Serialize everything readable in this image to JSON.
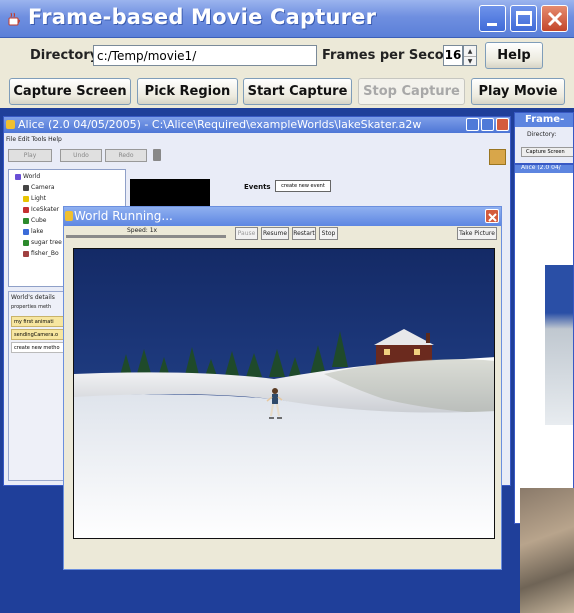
{
  "window": {
    "title": "Frame-based Movie Capturer"
  },
  "form": {
    "directory_label": "Directory:",
    "directory_value": "c:/Temp/movie1/",
    "fps_label": "Frames per Second:",
    "fps_value": "16",
    "help_label": "Help"
  },
  "toolbar": {
    "capture_screen": "Capture Screen",
    "pick_region": "Pick Region",
    "start_capture": "Start Capture",
    "stop_capture": "Stop Capture",
    "play_movie": "Play Movie"
  },
  "alice": {
    "title": "Alice (2.0 04/05/2005) - C:\\Alice\\Required\\exampleWorlds\\lakeSkater.a2w",
    "menu": "File  Edit  Tools  Help",
    "play": "Play",
    "undo": "Undo",
    "redo": "Redo",
    "tree": [
      {
        "label": "World",
        "color": "#6a4fd6"
      },
      {
        "label": "Camera",
        "color": "#444444"
      },
      {
        "label": "Light",
        "color": "#e8c400"
      },
      {
        "label": "IceSkater",
        "color": "#c43030"
      },
      {
        "label": "Cube",
        "color": "#2c8a2c"
      },
      {
        "label": "lake",
        "color": "#3b6bd8"
      },
      {
        "label": "sugar tree",
        "color": "#2c8a2c"
      },
      {
        "label": "fisher_Bo",
        "color": "#a04040"
      }
    ],
    "events_label": "Events",
    "events_button": "create new event",
    "world_details": "World's details",
    "details_tabs": "properties  meth",
    "details_rows": [
      "my first animati",
      "sendingCamera.o",
      "create new metho"
    ]
  },
  "mini_capturer": {
    "title": "Frame-",
    "directory": "Directory:",
    "capture": "Capture Screen"
  },
  "mini_alice": {
    "title": "Alice (2.0 04/"
  },
  "world_running": {
    "title": "World Running...",
    "speed": "Speed: 1x",
    "pause": "Pause",
    "resume": "Resume",
    "restart": "Restart",
    "stop": "Stop",
    "take_picture": "Take Picture"
  }
}
